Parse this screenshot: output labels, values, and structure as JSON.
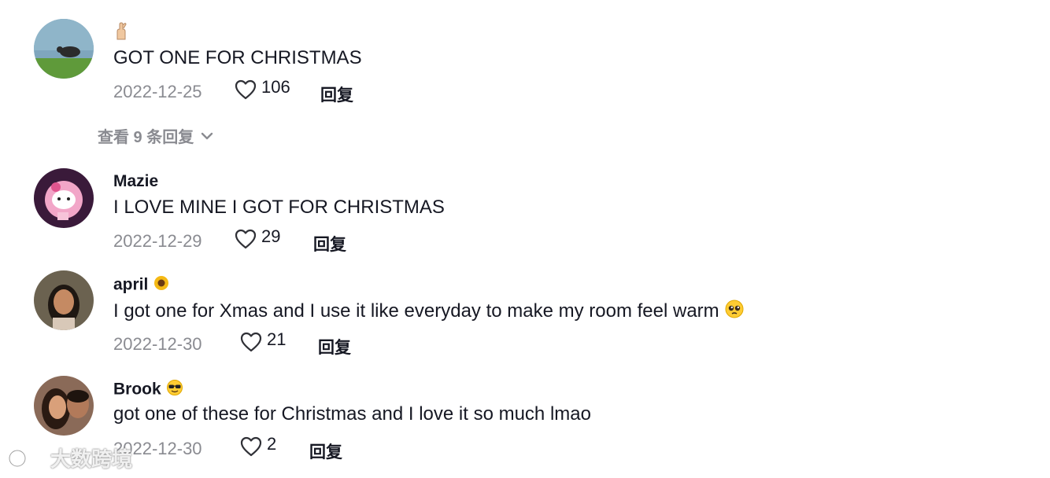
{
  "comments": [
    {
      "username": "",
      "text": "GOT ONE FOR CHRISTMAS",
      "date": "2022-12-25",
      "likes": "106",
      "reply_label": "回复"
    },
    {
      "username": "Mazie",
      "text": "I LOVE MINE I GOT FOR CHRISTMAS",
      "date": "2022-12-29",
      "likes": "29",
      "reply_label": "回复"
    },
    {
      "username": "april",
      "text": "I got one for Xmas and I use it like everyday to make my room feel warm",
      "date": "2022-12-30",
      "likes": "21",
      "reply_label": "回复"
    },
    {
      "username": "Brook",
      "text": "got one of these for Christmas and I love it so much lmao",
      "date": "2022-12-30",
      "likes": "2",
      "reply_label": "回复"
    }
  ],
  "view_replies": "查看 9 条回复",
  "watermark": "大数跨境",
  "icons": {
    "like": "heart-outline-icon",
    "expand": "chevron-down-icon",
    "emoji_1": "crossed-fingers-emoji",
    "emoji_2": "sunflower-emoji",
    "emoji_3": "pleading-face-emoji",
    "emoji_4": "sunglasses-face-emoji"
  },
  "colors": {
    "text": "#161823",
    "meta": "#8a8b91"
  }
}
